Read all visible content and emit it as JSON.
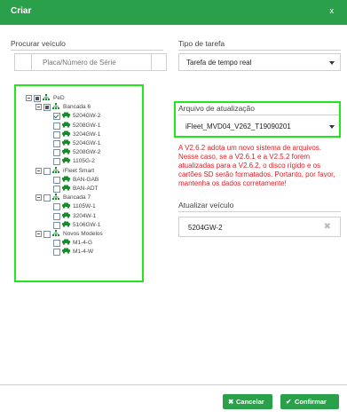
{
  "dialog": {
    "title": "Criar",
    "close_label": "x"
  },
  "left": {
    "search_label": "Procurar veículo",
    "search_placeholder": "Placa/Número de Série"
  },
  "right": {
    "task_type_label": "Tipo de tarefa",
    "task_type_value": "Tarefa de tempo real",
    "update_file_label": "Arquivo de atualização",
    "update_file_value": "iFleet_MVD04_V262_T19090201",
    "warning": "A V2.6.2 adota um novo sistema de arquivos. Nesse caso, se a V2.6.1 e a V2.5.2 forem atualizadas para a V2.6.2, o disco rígido e os cartões SD serão formatados. Portanto, por favor, mantenha os dados corretamente!",
    "update_vehicle_label": "Atualizar veículo",
    "update_vehicle_value": "5204GW-2"
  },
  "tree": [
    {
      "label": "PeD",
      "type": "group",
      "check": "partial",
      "expander": true
    },
    {
      "label": "Bancada 6",
      "type": "group",
      "check": "partial",
      "expander": true
    },
    {
      "label": "5204GW-2",
      "type": "vehicle",
      "check": "checked"
    },
    {
      "label": "5208GW-1",
      "type": "vehicle",
      "check": "none"
    },
    {
      "label": "3204GW-1",
      "type": "vehicle",
      "check": "none"
    },
    {
      "label": "5204GW-1",
      "type": "vehicle",
      "check": "none"
    },
    {
      "label": "5208GW-2",
      "type": "vehicle",
      "check": "none"
    },
    {
      "label": "1105G-2",
      "type": "vehicle",
      "check": "none"
    },
    {
      "label": "iFleet Smart",
      "type": "group",
      "check": "none",
      "expander": true
    },
    {
      "label": "BAN-GAB",
      "type": "vehicle",
      "check": "none"
    },
    {
      "label": "BAN-ADT",
      "type": "vehicle",
      "check": "none"
    },
    {
      "label": "Bancada 7",
      "type": "group",
      "check": "none",
      "expander": true
    },
    {
      "label": "1105W-1",
      "type": "vehicle",
      "check": "none"
    },
    {
      "label": "3204W-1",
      "type": "vehicle",
      "check": "none"
    },
    {
      "label": "5106GW-1",
      "type": "vehicle",
      "check": "none"
    },
    {
      "label": "Novos Modelos",
      "type": "group",
      "check": "none",
      "expander": true
    },
    {
      "label": "M1-4-G",
      "type": "vehicle",
      "check": "none"
    },
    {
      "label": "M1-4-W",
      "type": "vehicle",
      "check": "none"
    }
  ],
  "footer": {
    "cancel_label": "Cancelar",
    "confirm_label": "Confirmar"
  },
  "icons": {
    "group": "org-tree-icon",
    "vehicle": "car-icon",
    "cancel": "x-icon",
    "confirm": "check-icon"
  },
  "colors": {
    "accent": "#2aa04a",
    "highlight": "#22e51b",
    "warning": "#e31b23"
  }
}
